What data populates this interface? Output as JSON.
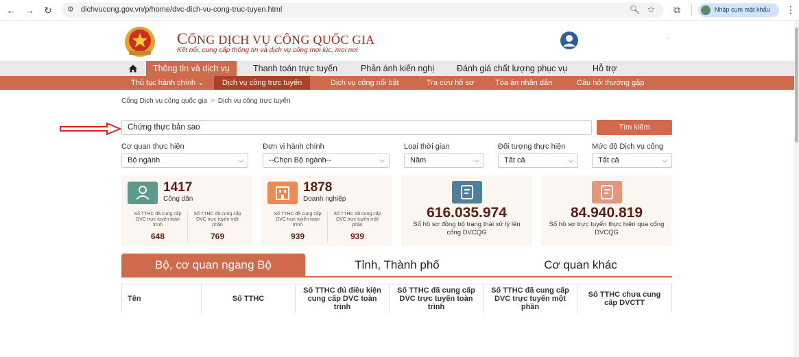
{
  "browser": {
    "url": "dichvucong.gov.vn/p/home/dvc-dich-vu-cong-truc-tuyen.html",
    "profile_label": "Nhập cụm mật khẩu"
  },
  "site": {
    "title_first": "C",
    "title_rest": "ỔNG DỊCH VỤ CÔNG QUỐC GIA",
    "tagline": "Kết nối, cung cấp thông tin và dịch vụ công mọi lúc, mọi nơi"
  },
  "menu": [
    {
      "label": "Thông tin và dịch vụ",
      "active": true
    },
    {
      "label": "Thanh toán trực tuyến"
    },
    {
      "label": "Phản ánh kiến nghị"
    },
    {
      "label": "Đánh giá chất lượng phục vụ"
    },
    {
      "label": "Hỗ trợ"
    }
  ],
  "submenu": [
    {
      "label": "Thủ tục hành chính ⌄"
    },
    {
      "label": "Dịch vụ công trực tuyến",
      "active": true
    },
    {
      "label": "Dịch vụ công nổi bật"
    },
    {
      "label": "Tra cứu hồ sơ"
    },
    {
      "label": "Tòa án nhân dân"
    },
    {
      "label": "Câu hỏi thường gặp"
    }
  ],
  "breadcrumb": [
    "Cổng Dịch vụ công quốc gia",
    "Dịch vụ công trực tuyến"
  ],
  "search": {
    "value": "Chứng thực bản sao",
    "button": "Tìm kiếm"
  },
  "filters": [
    {
      "label": "Cơ quan thực hiện",
      "value": "Bộ ngành"
    },
    {
      "label": "Đơn vị hành chính",
      "value": "--Chọn Bộ ngành--"
    },
    {
      "label": "Loại thời gian",
      "value": "Năm"
    },
    {
      "label": "Đối tượng thực hiện",
      "value": "Tất cả"
    },
    {
      "label": "Mức độ Dịch vụ công",
      "value": "Tất cả"
    }
  ],
  "cards": {
    "citizen": {
      "count": "1417",
      "label": "Công dân",
      "sub1_label": "Số TTHC đã cung cấp DVC trực tuyến toàn trình",
      "sub1_value": "648",
      "sub2_label": "Số TTHC đã cung cấp DVC trực tuyến một phần",
      "sub2_value": "769"
    },
    "business": {
      "count": "1878",
      "label": "Doanh nghiệp",
      "sub1_label": "Số TTHC đã cung cấp DVC trực tuyến toàn trình",
      "sub1_value": "939",
      "sub2_label": "Số TTHC đã cung cấp DVC trực tuyến một phần",
      "sub2_value": "939"
    },
    "synced": {
      "count": "616.035.974",
      "label": "Số hồ sơ đồng bộ trạng thái xử lý lên cổng DVCQG"
    },
    "online": {
      "count": "84.940.819",
      "label": "Số hồ sơ trực tuyến thực hiện qua cổng DVCQG"
    }
  },
  "tabs": [
    {
      "label": "Bộ, cơ quan ngang Bộ",
      "active": true
    },
    {
      "label": "Tỉnh, Thành phố"
    },
    {
      "label": "Cơ quan khác"
    }
  ],
  "table": {
    "headers": [
      "Tên",
      "Số TTHC",
      "Số TTHC đủ điều kiện cung cấp DVC toàn trình",
      "Số TTHC đã cung cấp DVC trực tuyến toàn trình",
      "Số TTHC đã cung cấp DVC trực tuyến một phần",
      "Số TTHC chưa cung cấp DVCTT"
    ]
  },
  "colors": {
    "accent": "#cf6b4c",
    "accent_dark": "#a94228",
    "title_red": "#b3261e",
    "number_brown": "#5b1f12",
    "card_bg": "#fbf6f2",
    "icon_green": "#5b9a8b",
    "icon_orange": "#ec8a52",
    "icon_blue": "#4f7f9c",
    "icon_peach": "#e6967b"
  }
}
